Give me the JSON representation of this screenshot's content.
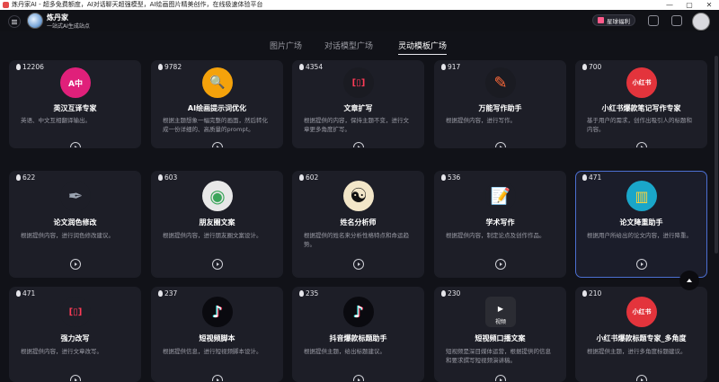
{
  "window": {
    "title": "炼丹家AI - 超多免费额度，AI对话聊天超强模型，AI绘画图片精美创作，在线极速体验平台",
    "minimize": "—",
    "maximize": "▢",
    "close": "✕"
  },
  "header": {
    "brand_name": "炼丹家",
    "brand_sub": "一站式AI生成站点",
    "promo_label": "星球福利"
  },
  "tabs": [
    {
      "label": "图片广场",
      "active": false
    },
    {
      "label": "对话模型广场",
      "active": false
    },
    {
      "label": "灵动模板广场",
      "active": true
    }
  ],
  "cards": [
    {
      "count": "12206",
      "name": "英汉互译专家",
      "desc": "英语、中文互相翻译输出。",
      "icon": "translate-icon",
      "icon_bg": "#e0207a",
      "icon_text": "A中"
    },
    {
      "count": "9782",
      "name": "AI绘画提示词优化",
      "desc": "根据主题想象一幅完整的画面，然后转化成一份详细的、高质量的prompt。",
      "icon": "magnifier-icon",
      "icon_bg": "#f4a20b",
      "icon_text": "🔍"
    },
    {
      "count": "4354",
      "name": "文章扩写",
      "desc": "根据提供的内容，保持主题不变，进行文章更多角度扩写。",
      "icon": "book-open-icon",
      "icon_bg": "#1a1b22",
      "icon_text": "[▯]"
    },
    {
      "count": "917",
      "name": "万能写作助手",
      "desc": "根据提供内容，进行写作。",
      "icon": "pen-paper-icon",
      "icon_bg": "#1a1b22",
      "icon_text": "✎"
    },
    {
      "count": "700",
      "name": "小红书爆款笔记写作专家",
      "desc": "基于用户的需求，创作出吸引人的标题和内容。",
      "icon": "xiaohongshu-icon",
      "icon_bg": "#e3343c",
      "icon_text": "小红书"
    },
    {
      "count": "622",
      "name": "论文润色修改",
      "desc": "根据提供内容，进行润色修改建议。",
      "icon": "fountain-pen-icon",
      "icon_bg": "#1d1e27",
      "icon_text": "✒"
    },
    {
      "count": "603",
      "name": "朋友圈文案",
      "desc": "根据提供内容，进行朋友圈文案设计。",
      "icon": "moments-icon",
      "icon_bg": "#e8e8e8",
      "icon_text": "◉"
    },
    {
      "count": "602",
      "name": "姓名分析师",
      "desc": "根据提供的姓名来分析性格特点和命运趋势。",
      "icon": "yin-yang-icon",
      "icon_bg": "#f2e6c8",
      "icon_text": "☯"
    },
    {
      "count": "536",
      "name": "学术写作",
      "desc": "根据提供内容，制定论点及创作作品。",
      "icon": "document-pen-icon",
      "icon_bg": "#1d1e27",
      "icon_text": "📝"
    },
    {
      "count": "471",
      "name": "论文降重助手",
      "desc": "根据用户所给出的论文内容，进行降重。",
      "icon": "document-reduce-icon",
      "icon_bg": "#1aa6c9",
      "icon_text": "▥"
    },
    {
      "count": "471",
      "name": "强力改写",
      "desc": "根据提供内容，进行文章改写。",
      "icon": "book-open-icon",
      "icon_bg": "#1d1e27",
      "icon_text": "[▯]"
    },
    {
      "count": "237",
      "name": "短视频脚本",
      "desc": "根据提供信息，进行短视频脚本设计。",
      "icon": "tiktok-icon",
      "icon_bg": "#0a0a0f",
      "icon_text": "♪"
    },
    {
      "count": "235",
      "name": "抖音爆款标题助手",
      "desc": "根据提供主题，给出标题建议。",
      "icon": "tiktok-icon",
      "icon_bg": "#0a0a0f",
      "icon_text": "♪"
    },
    {
      "count": "230",
      "name": "短视频口播文案",
      "desc": "短视频是深目媒体运营，根据提供的信息和要求撰写短视频演讲稿。",
      "icon": "video-icon",
      "icon_bg": "#2b2c33",
      "icon_text": "▶"
    },
    {
      "count": "210",
      "name": "小红书爆款标题专家_多角度",
      "desc": "根据提供主题，进行多角度标题建议。",
      "icon": "xiaohongshu-icon",
      "icon_bg": "#e3343c",
      "icon_text": "小红书"
    }
  ],
  "video_icon_label": "视频"
}
